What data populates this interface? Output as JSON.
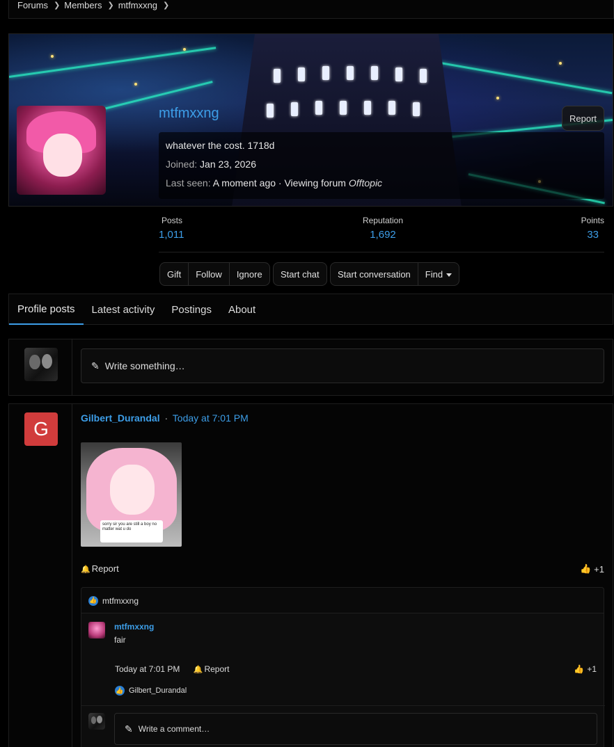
{
  "breadcrumb": [
    "Forums",
    "Members",
    "mtfmxxng"
  ],
  "profile": {
    "username": "mtfmxxng",
    "report_label": "Report",
    "status": "whatever the cost. 1718d",
    "joined_label": "Joined:",
    "joined_value": "Jan 23, 2026",
    "last_seen_label": "Last seen:",
    "last_seen_value": "A moment ago",
    "viewing_label": "· Viewing forum",
    "viewing_forum": "Offtopic"
  },
  "stats": {
    "posts_label": "Posts",
    "posts_value": "1,011",
    "reputation_label": "Reputation",
    "reputation_value": "1,692",
    "points_label": "Points",
    "points_value": "33"
  },
  "actions": {
    "gift": "Gift",
    "follow": "Follow",
    "ignore": "Ignore",
    "start_chat": "Start chat",
    "start_conversation": "Start conversation",
    "find": "Find"
  },
  "tabs": [
    "Profile posts",
    "Latest activity",
    "Postings",
    "About"
  ],
  "write_placeholder": "Write something…",
  "post": {
    "avatar_letter": "G",
    "author": "Gilbert_Durandal",
    "separator": "·",
    "time": "Today at 7:01 PM",
    "report_label": "Report",
    "like_label": "+1",
    "reacted_by": "mtfmxxng",
    "image_caption": "sorry sir you are still a boy no matter wat u do"
  },
  "comment": {
    "author": "mtfmxxng",
    "text": "fair",
    "time": "Today at 7:01 PM",
    "report_label": "Report",
    "like_label": "+1",
    "reacted_by": "Gilbert_Durandal"
  },
  "comment_placeholder": "Write a comment…",
  "colors": {
    "accent": "#3d9ee8",
    "background": "#000000",
    "avatar_g": "#d13c3c"
  }
}
